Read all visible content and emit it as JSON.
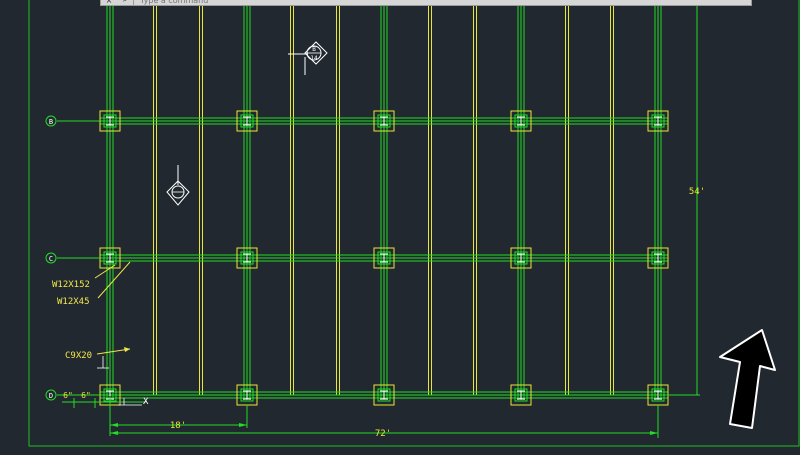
{
  "command_line": {
    "placeholder": "Type a command",
    "close_label": "×",
    "tool_label": "⌕"
  },
  "drawing": {
    "grid_bubbles": [
      "B",
      "C",
      "D"
    ],
    "section_marker_top": {
      "top": "B",
      "bottom": "14"
    },
    "section_marker_left": {
      "top": "",
      "bottom": ""
    },
    "labels": {
      "column": "W12X152",
      "beam": "W12X45",
      "channel": "C9X20",
      "dim_a": "6\"",
      "dim_b": "6\"",
      "dim_bay": "18'",
      "dim_total_width": "72'",
      "dim_total_height": "54'"
    },
    "colors": {
      "background": "#212830",
      "beam_green": "#22dd22",
      "joist_yellow": "#e8e832",
      "label_yellow": "#f2e84a",
      "outline_green": "#1fbf1f",
      "white": "#ffffff",
      "arrow": "#000000"
    }
  }
}
